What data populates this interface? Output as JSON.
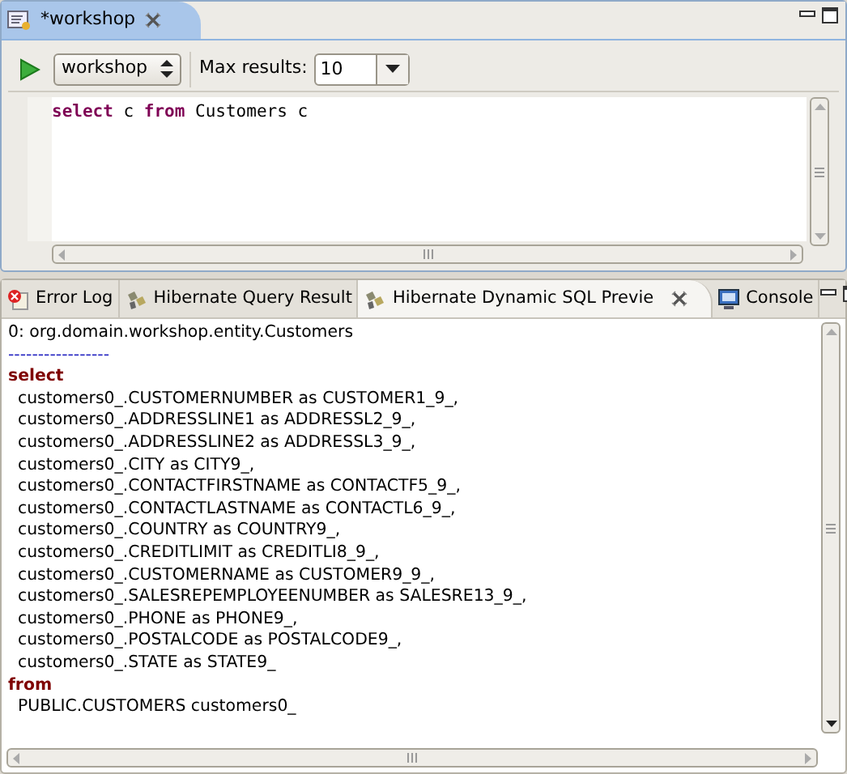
{
  "editor_panel": {
    "tabs": [
      {
        "label": "*workshop",
        "selected": true
      }
    ],
    "toolbar": {
      "configuration": "workshop",
      "max_results_label": "Max results:",
      "max_results": "10"
    },
    "query": [
      {
        "kind": "keyword",
        "text": "select"
      },
      {
        "kind": "plain",
        "text": " c "
      },
      {
        "kind": "keyword",
        "text": "from"
      },
      {
        "kind": "plain",
        "text": " Customers c"
      }
    ]
  },
  "views_panel": {
    "tabs": [
      {
        "label": "Error Log",
        "kind": "error",
        "selected": false
      },
      {
        "label": "Hibernate Query Result",
        "kind": "hibernate",
        "selected": false
      },
      {
        "label": "Hibernate Dynamic SQL Previe",
        "kind": "hibernate",
        "selected": true
      },
      {
        "label": "Console",
        "kind": "console",
        "selected": false
      }
    ],
    "lines": [
      {
        "kind": "header",
        "text": "0: org.domain.workshop.entity.Customers"
      },
      {
        "kind": "separator",
        "text": "-----------------"
      },
      {
        "kind": "keyword",
        "text": "select"
      },
      {
        "kind": "column",
        "text": "customers0_.CUSTOMERNUMBER as CUSTOMER1_9_,"
      },
      {
        "kind": "column",
        "text": "customers0_.ADDRESSLINE1 as ADDRESSL2_9_,"
      },
      {
        "kind": "column",
        "text": "customers0_.ADDRESSLINE2 as ADDRESSL3_9_,"
      },
      {
        "kind": "column",
        "text": "customers0_.CITY as CITY9_,"
      },
      {
        "kind": "column",
        "text": "customers0_.CONTACTFIRSTNAME as CONTACTF5_9_,"
      },
      {
        "kind": "column",
        "text": "customers0_.CONTACTLASTNAME as CONTACTL6_9_,"
      },
      {
        "kind": "column",
        "text": "customers0_.COUNTRY as COUNTRY9_,"
      },
      {
        "kind": "column",
        "text": "customers0_.CREDITLIMIT as CREDITLI8_9_,"
      },
      {
        "kind": "column",
        "text": "customers0_.CUSTOMERNAME as CUSTOMER9_9_,"
      },
      {
        "kind": "column",
        "text": "customers0_.SALESREPEMPLOYEENUMBER as SALESRE13_9_,"
      },
      {
        "kind": "column",
        "text": "customers0_.PHONE as PHONE9_,"
      },
      {
        "kind": "column",
        "text": "customers0_.POSTALCODE as POSTALCODE9_,"
      },
      {
        "kind": "column",
        "text": "customers0_.STATE as STATE9_"
      },
      {
        "kind": "keyword",
        "text": "from"
      },
      {
        "kind": "column",
        "text": "PUBLIC.CUSTOMERS customers0_"
      }
    ]
  }
}
